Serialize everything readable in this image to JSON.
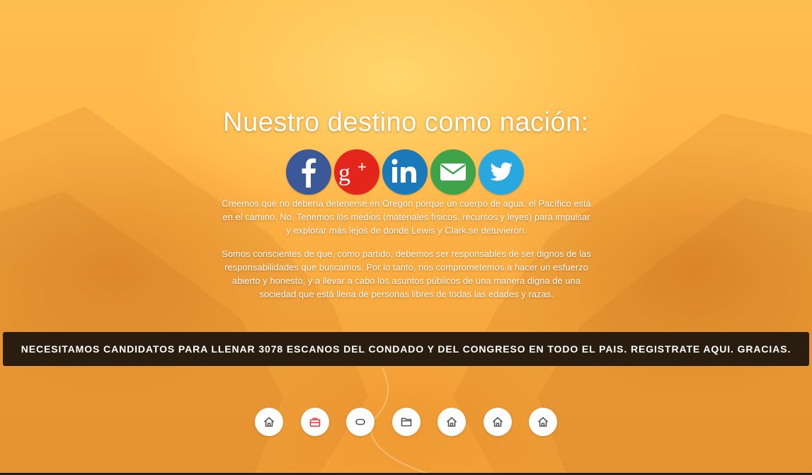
{
  "hero": {
    "title": "Nuestro destino como nación:",
    "paragraph_1": "Creemos que no debería detenerse en Oregon porque un cuerpo de agua: el Pacífico está en el camino. No. Tenemos los medios (materiales físicos, recursos y leyes) para impulsar y explorar más lejos de donde Lewis y Clark se detuvieron.",
    "paragraph_2": "Somos conscientes de que, como partido, debemos ser responsables de ser dignos de las responsabilidades que buscamos. Por lo tanto, nos comprometemos a hacer un esfuerzo abierto y honesto, y a llevar a cabo los asuntos públicos de una manera digna de una sociedad que está llena de personas libres de todas las edades y razas."
  },
  "social": [
    {
      "icon": "facebook-icon",
      "color": "#3b5998"
    },
    {
      "icon": "google-plus-icon",
      "color": "#e4251b"
    },
    {
      "icon": "linkedin-icon",
      "color": "#1a79b8"
    },
    {
      "icon": "email-icon",
      "color": "#3fa34a"
    },
    {
      "icon": "twitter-icon",
      "color": "#29a8e0"
    }
  ],
  "banner": {
    "text": "NECESITAMOS CANDIDATOS PARA LLENAR 3078 ESCANOS DEL CONDADO Y DEL CONGRESO EN TODO EL PAIS. REGISTRATE AQUI. GRACIAS."
  },
  "nav_icons": [
    "home-icon",
    "briefcase-icon",
    "chat-icon",
    "folder-icon",
    "home-icon",
    "home-icon",
    "home-icon"
  ],
  "colors": {
    "background": "#ffb548",
    "banner_bg": "#2a1d0f",
    "briefcase_accent": "#e5393f"
  }
}
